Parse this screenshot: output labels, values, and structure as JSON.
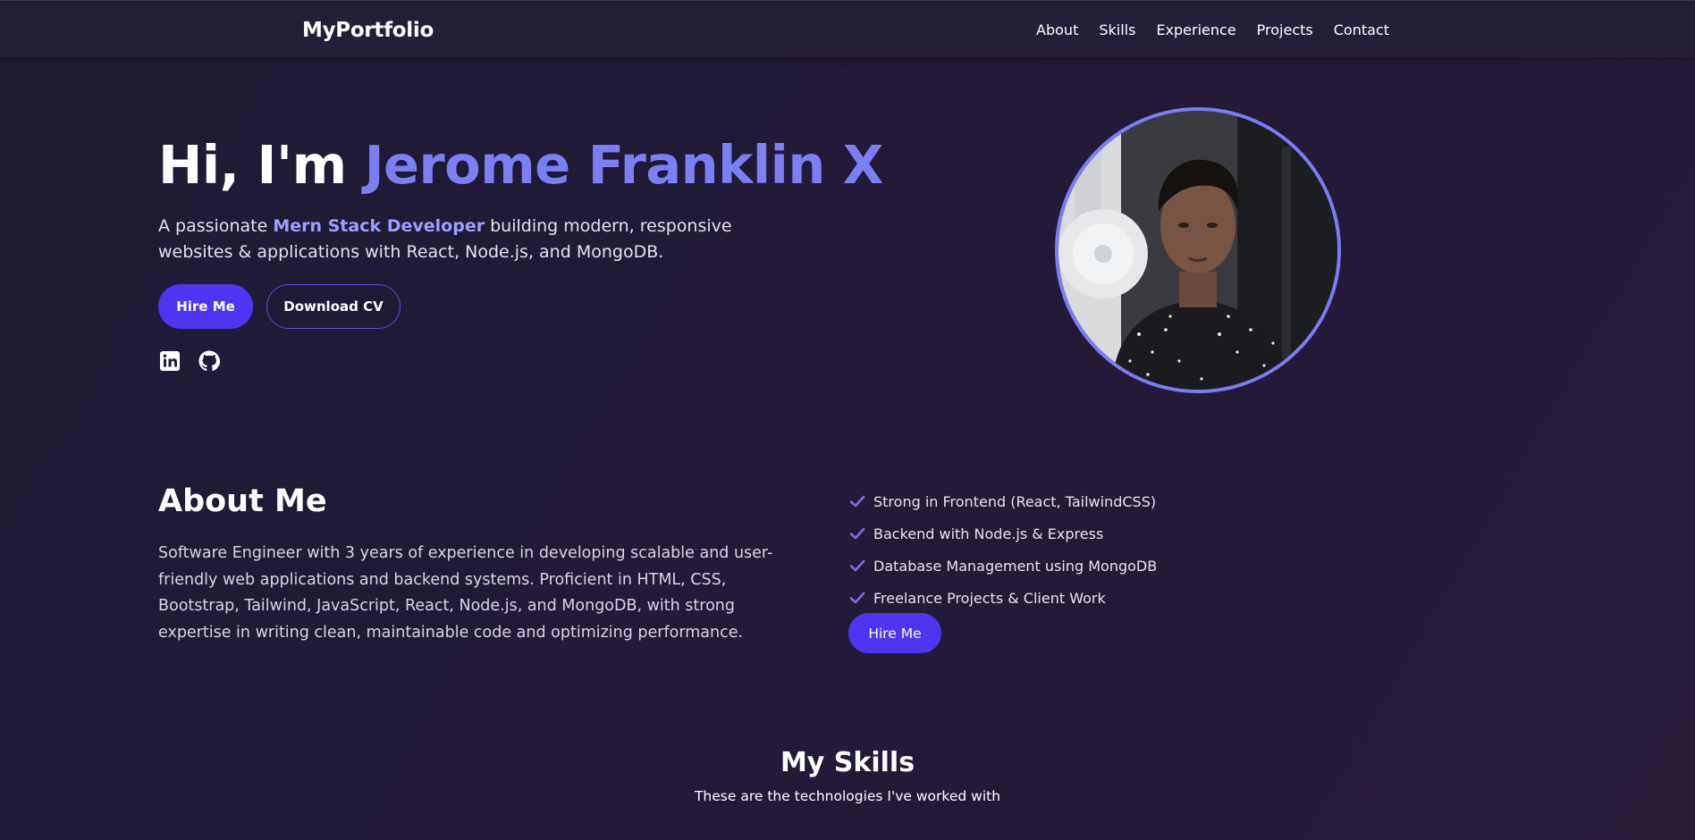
{
  "nav": {
    "brand": "MyPortfolio",
    "links": [
      "About",
      "Skills",
      "Experience",
      "Projects",
      "Contact"
    ]
  },
  "hero": {
    "greeting": "Hi, I'm ",
    "name": "Jerome Franklin X",
    "desc_prefix": "A passionate ",
    "desc_highlight": "Mern Stack Developer",
    "desc_suffix": " building modern, responsive websites & applications with React, Node.js, and MongoDB.",
    "hire_label": "Hire Me",
    "cv_label": "Download CV",
    "social_icons": [
      "linkedin-icon",
      "github-icon"
    ]
  },
  "about": {
    "title": "About Me",
    "text": "Software Engineer with 3 years of experience in developing scalable and user-friendly web applications and backend systems. Proficient in HTML, CSS, Bootstrap, Tailwind, JavaScript, React, Node.js, and MongoDB, with strong expertise in writing clean, maintainable code and optimizing performance.",
    "features": [
      "Strong in Frontend (React, TailwindCSS)",
      "Backend with Node.js & Express",
      "Database Management using MongoDB",
      "Freelance Projects & Client Work"
    ],
    "hire_label": "Hire Me"
  },
  "skills": {
    "title": "My Skills",
    "subtitle": "These are the technologies I've worked with"
  },
  "colors": {
    "accent": "#7c7ff4",
    "button": "#4f35f1",
    "check": "#7f6ce6",
    "background": "#1f1b35"
  }
}
